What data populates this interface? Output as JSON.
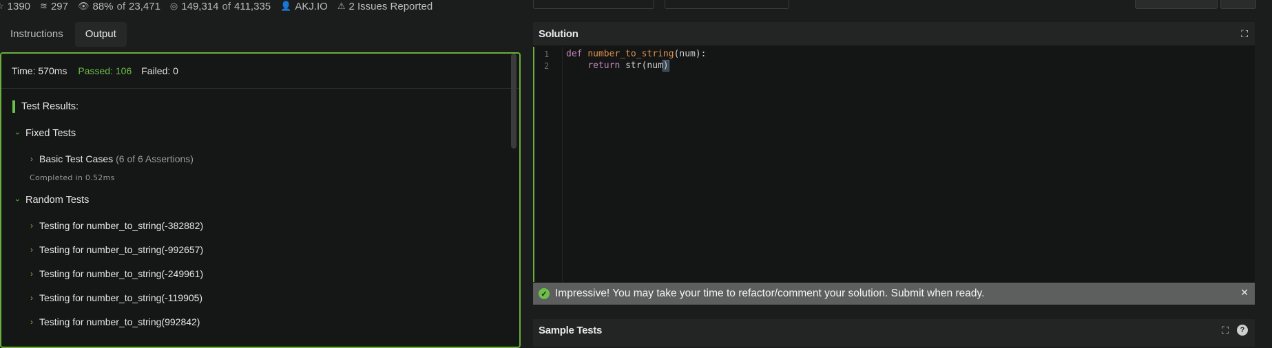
{
  "stats": {
    "stars": "1390",
    "collections": "297",
    "satisfaction": "88%",
    "satisfaction_of": "of",
    "satisfaction_total": "23,471",
    "completed": "149,314",
    "completed_of": "of",
    "completed_total": "411,335",
    "author": "AKJ.IO",
    "issues": "2 Issues Reported"
  },
  "tabs": [
    {
      "label": "Instructions"
    },
    {
      "label": "Output"
    }
  ],
  "output": {
    "time": "Time: 570ms",
    "passed": "Passed: 106",
    "failed": "Failed: 0",
    "results_title": "Test Results:",
    "fixed_tests": "Fixed Tests",
    "basic_cases": "Basic Test Cases",
    "basic_assertions": "(6 of 6 Assertions)",
    "completed_in": "Completed in 0.52ms",
    "random_tests": "Random Tests",
    "random_items": [
      "Testing for number_to_string(-382882)",
      "Testing for number_to_string(-992657)",
      "Testing for number_to_string(-249961)",
      "Testing for number_to_string(-119905)",
      "Testing for number_to_string(992842)"
    ]
  },
  "solution": {
    "title": "Solution",
    "line_numbers": [
      "1",
      "2"
    ],
    "code": {
      "line1_kw": "def",
      "line1_fn": "number_to_string",
      "line1_rest": "(num):",
      "line2_kw": "return",
      "line2_rest": " str(num",
      "line2_cursor": ")"
    }
  },
  "banner": {
    "message": "Impressive! You may take your time to refactor/comment your solution. Submit when ready."
  },
  "sample_tests": {
    "title": "Sample Tests"
  },
  "colors": {
    "accent_green": "#6bb03b",
    "passed_green": "#6cbf4a",
    "panel_bg": "#151616",
    "page_bg": "#1b1c1c"
  }
}
